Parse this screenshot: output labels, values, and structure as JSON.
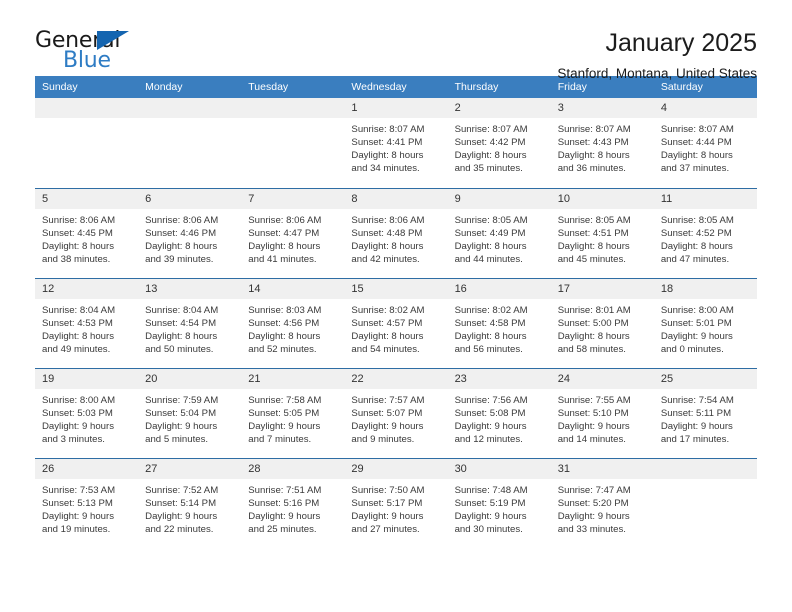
{
  "brand": {
    "name_top": "General",
    "name_bottom": "Blue",
    "triangle_color": "#1565b0",
    "blue_color": "#2e7cc4"
  },
  "header": {
    "title": "January 2025",
    "subtitle": "Stanford, Montana, United States",
    "header_bg": "#3a7ebf",
    "row_border": "#2e6da4",
    "daynum_bg": "#f0f0f0"
  },
  "weekday_headers": [
    "Sunday",
    "Monday",
    "Tuesday",
    "Wednesday",
    "Thursday",
    "Friday",
    "Saturday"
  ],
  "labels": {
    "sunrise_prefix": "Sunrise:",
    "sunset_prefix": "Sunset:",
    "daylight_prefix": "Daylight:"
  },
  "weeks": [
    [
      {
        "day": "",
        "line1": "",
        "line2": "",
        "line3": "",
        "line4": ""
      },
      {
        "day": "",
        "line1": "",
        "line2": "",
        "line3": "",
        "line4": ""
      },
      {
        "day": "",
        "line1": "",
        "line2": "",
        "line3": "",
        "line4": ""
      },
      {
        "day": "1",
        "line1": "Sunrise: 8:07 AM",
        "line2": "Sunset: 4:41 PM",
        "line3": "Daylight: 8 hours",
        "line4": "and 34 minutes."
      },
      {
        "day": "2",
        "line1": "Sunrise: 8:07 AM",
        "line2": "Sunset: 4:42 PM",
        "line3": "Daylight: 8 hours",
        "line4": "and 35 minutes."
      },
      {
        "day": "3",
        "line1": "Sunrise: 8:07 AM",
        "line2": "Sunset: 4:43 PM",
        "line3": "Daylight: 8 hours",
        "line4": "and 36 minutes."
      },
      {
        "day": "4",
        "line1": "Sunrise: 8:07 AM",
        "line2": "Sunset: 4:44 PM",
        "line3": "Daylight: 8 hours",
        "line4": "and 37 minutes."
      }
    ],
    [
      {
        "day": "5",
        "line1": "Sunrise: 8:06 AM",
        "line2": "Sunset: 4:45 PM",
        "line3": "Daylight: 8 hours",
        "line4": "and 38 minutes."
      },
      {
        "day": "6",
        "line1": "Sunrise: 8:06 AM",
        "line2": "Sunset: 4:46 PM",
        "line3": "Daylight: 8 hours",
        "line4": "and 39 minutes."
      },
      {
        "day": "7",
        "line1": "Sunrise: 8:06 AM",
        "line2": "Sunset: 4:47 PM",
        "line3": "Daylight: 8 hours",
        "line4": "and 41 minutes."
      },
      {
        "day": "8",
        "line1": "Sunrise: 8:06 AM",
        "line2": "Sunset: 4:48 PM",
        "line3": "Daylight: 8 hours",
        "line4": "and 42 minutes."
      },
      {
        "day": "9",
        "line1": "Sunrise: 8:05 AM",
        "line2": "Sunset: 4:49 PM",
        "line3": "Daylight: 8 hours",
        "line4": "and 44 minutes."
      },
      {
        "day": "10",
        "line1": "Sunrise: 8:05 AM",
        "line2": "Sunset: 4:51 PM",
        "line3": "Daylight: 8 hours",
        "line4": "and 45 minutes."
      },
      {
        "day": "11",
        "line1": "Sunrise: 8:05 AM",
        "line2": "Sunset: 4:52 PM",
        "line3": "Daylight: 8 hours",
        "line4": "and 47 minutes."
      }
    ],
    [
      {
        "day": "12",
        "line1": "Sunrise: 8:04 AM",
        "line2": "Sunset: 4:53 PM",
        "line3": "Daylight: 8 hours",
        "line4": "and 49 minutes."
      },
      {
        "day": "13",
        "line1": "Sunrise: 8:04 AM",
        "line2": "Sunset: 4:54 PM",
        "line3": "Daylight: 8 hours",
        "line4": "and 50 minutes."
      },
      {
        "day": "14",
        "line1": "Sunrise: 8:03 AM",
        "line2": "Sunset: 4:56 PM",
        "line3": "Daylight: 8 hours",
        "line4": "and 52 minutes."
      },
      {
        "day": "15",
        "line1": "Sunrise: 8:02 AM",
        "line2": "Sunset: 4:57 PM",
        "line3": "Daylight: 8 hours",
        "line4": "and 54 minutes."
      },
      {
        "day": "16",
        "line1": "Sunrise: 8:02 AM",
        "line2": "Sunset: 4:58 PM",
        "line3": "Daylight: 8 hours",
        "line4": "and 56 minutes."
      },
      {
        "day": "17",
        "line1": "Sunrise: 8:01 AM",
        "line2": "Sunset: 5:00 PM",
        "line3": "Daylight: 8 hours",
        "line4": "and 58 minutes."
      },
      {
        "day": "18",
        "line1": "Sunrise: 8:00 AM",
        "line2": "Sunset: 5:01 PM",
        "line3": "Daylight: 9 hours",
        "line4": "and 0 minutes."
      }
    ],
    [
      {
        "day": "19",
        "line1": "Sunrise: 8:00 AM",
        "line2": "Sunset: 5:03 PM",
        "line3": "Daylight: 9 hours",
        "line4": "and 3 minutes."
      },
      {
        "day": "20",
        "line1": "Sunrise: 7:59 AM",
        "line2": "Sunset: 5:04 PM",
        "line3": "Daylight: 9 hours",
        "line4": "and 5 minutes."
      },
      {
        "day": "21",
        "line1": "Sunrise: 7:58 AM",
        "line2": "Sunset: 5:05 PM",
        "line3": "Daylight: 9 hours",
        "line4": "and 7 minutes."
      },
      {
        "day": "22",
        "line1": "Sunrise: 7:57 AM",
        "line2": "Sunset: 5:07 PM",
        "line3": "Daylight: 9 hours",
        "line4": "and 9 minutes."
      },
      {
        "day": "23",
        "line1": "Sunrise: 7:56 AM",
        "line2": "Sunset: 5:08 PM",
        "line3": "Daylight: 9 hours",
        "line4": "and 12 minutes."
      },
      {
        "day": "24",
        "line1": "Sunrise: 7:55 AM",
        "line2": "Sunset: 5:10 PM",
        "line3": "Daylight: 9 hours",
        "line4": "and 14 minutes."
      },
      {
        "day": "25",
        "line1": "Sunrise: 7:54 AM",
        "line2": "Sunset: 5:11 PM",
        "line3": "Daylight: 9 hours",
        "line4": "and 17 minutes."
      }
    ],
    [
      {
        "day": "26",
        "line1": "Sunrise: 7:53 AM",
        "line2": "Sunset: 5:13 PM",
        "line3": "Daylight: 9 hours",
        "line4": "and 19 minutes."
      },
      {
        "day": "27",
        "line1": "Sunrise: 7:52 AM",
        "line2": "Sunset: 5:14 PM",
        "line3": "Daylight: 9 hours",
        "line4": "and 22 minutes."
      },
      {
        "day": "28",
        "line1": "Sunrise: 7:51 AM",
        "line2": "Sunset: 5:16 PM",
        "line3": "Daylight: 9 hours",
        "line4": "and 25 minutes."
      },
      {
        "day": "29",
        "line1": "Sunrise: 7:50 AM",
        "line2": "Sunset: 5:17 PM",
        "line3": "Daylight: 9 hours",
        "line4": "and 27 minutes."
      },
      {
        "day": "30",
        "line1": "Sunrise: 7:48 AM",
        "line2": "Sunset: 5:19 PM",
        "line3": "Daylight: 9 hours",
        "line4": "and 30 minutes."
      },
      {
        "day": "31",
        "line1": "Sunrise: 7:47 AM",
        "line2": "Sunset: 5:20 PM",
        "line3": "Daylight: 9 hours",
        "line4": "and 33 minutes."
      },
      {
        "day": "",
        "line1": "",
        "line2": "",
        "line3": "",
        "line4": ""
      }
    ]
  ]
}
